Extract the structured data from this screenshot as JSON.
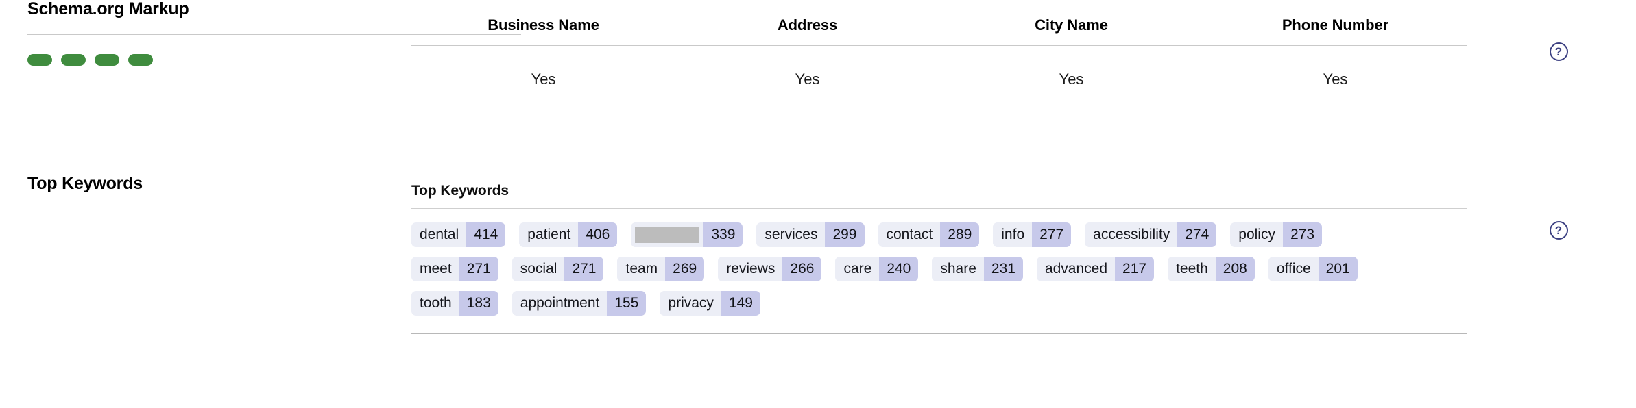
{
  "sections": {
    "schema": {
      "side_title": "Schema.org Markup",
      "status_pill_count": 4,
      "status_pill_color": "#3f8c3e",
      "help_label": "?",
      "table": {
        "columns": [
          "Business Name",
          "Address",
          "City Name",
          "Phone Number"
        ],
        "rows": [
          [
            "Yes",
            "Yes",
            "Yes",
            "Yes"
          ]
        ]
      }
    },
    "keywords": {
      "side_title": "Top Keywords",
      "panel_title": "Top Keywords",
      "help_label": "?",
      "rows": [
        [
          {
            "label": "dental",
            "count": "414",
            "redacted": false
          },
          {
            "label": "patient",
            "count": "406",
            "redacted": false
          },
          {
            "label": "",
            "count": "339",
            "redacted": true
          },
          {
            "label": "services",
            "count": "299",
            "redacted": false
          },
          {
            "label": "contact",
            "count": "289",
            "redacted": false
          },
          {
            "label": "info",
            "count": "277",
            "redacted": false
          },
          {
            "label": "accessibility",
            "count": "274",
            "redacted": false
          },
          {
            "label": "policy",
            "count": "273",
            "redacted": false
          }
        ],
        [
          {
            "label": "meet",
            "count": "271",
            "redacted": false
          },
          {
            "label": "social",
            "count": "271",
            "redacted": false
          },
          {
            "label": "team",
            "count": "269",
            "redacted": false
          },
          {
            "label": "reviews",
            "count": "266",
            "redacted": false
          },
          {
            "label": "care",
            "count": "240",
            "redacted": false
          },
          {
            "label": "share",
            "count": "231",
            "redacted": false
          },
          {
            "label": "advanced",
            "count": "217",
            "redacted": false
          },
          {
            "label": "teeth",
            "count": "208",
            "redacted": false
          },
          {
            "label": "office",
            "count": "201",
            "redacted": false
          }
        ],
        [
          {
            "label": "tooth",
            "count": "183",
            "redacted": false
          },
          {
            "label": "appointment",
            "count": "155",
            "redacted": false
          },
          {
            "label": "privacy",
            "count": "149",
            "redacted": false
          }
        ]
      ]
    }
  },
  "colors": {
    "pill_green": "#3f8c3e",
    "chip_label_bg": "#eceef6",
    "chip_count_bg": "#c7c9ea",
    "help_icon": "#3b3f81",
    "redaction": "#bcbcbc"
  }
}
